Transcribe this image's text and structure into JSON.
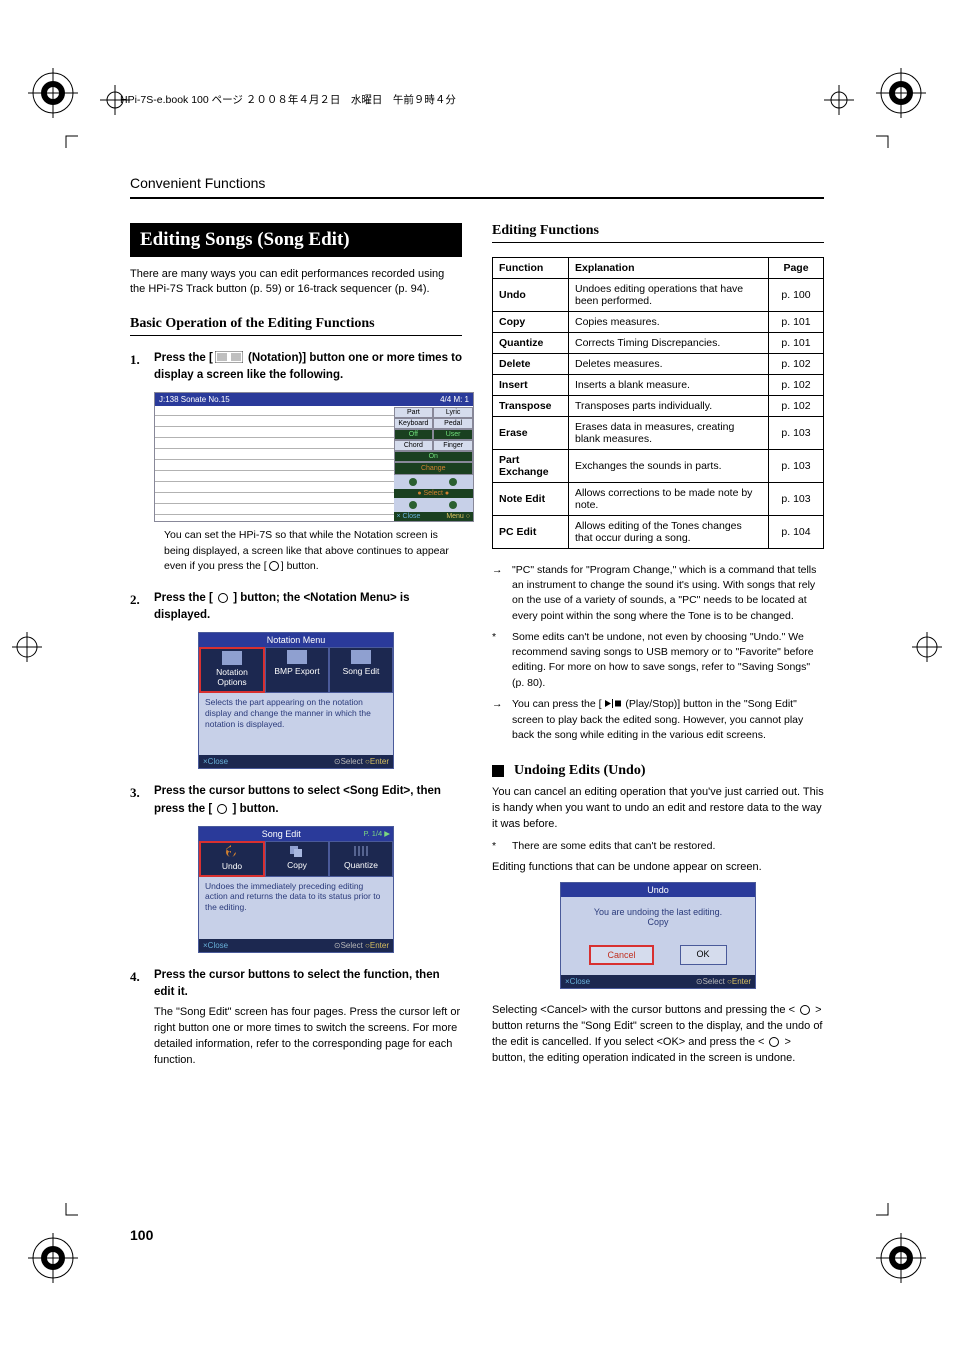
{
  "print_header": "HPi-7S-e.book  100 ページ  ２００８年４月２日　水曜日　午前９時４分",
  "running_head": "Convenient Functions",
  "title": "Editing Songs (Song Edit)",
  "intro": "There are many ways you can edit performances recorded using the HPi-7S Track button (p. 59) or 16-track sequencer (p. 94).",
  "h2_basic": "Basic Operation of the Editing Functions",
  "steps": {
    "s1": {
      "num": "1.",
      "pre": "Press the [",
      "post": " (Notation)] button one or more times to display a screen like the following."
    },
    "cap1": {
      "a": "You can set the HPi-7S so that while the Notation screen is being displayed, a screen like that above continues to appear even if you press the [",
      "b": "] button."
    },
    "s2": {
      "num": "2.",
      "pre": "Press the [ ",
      "post": " ] button; the <Notation Menu> is displayed."
    },
    "s3": {
      "num": "3.",
      "pre": "Press the cursor buttons to select <Song Edit>, then press the [ ",
      "post": " ] button."
    },
    "s4": {
      "num": "4.",
      "text": "Press the cursor buttons to select the function, then edit it."
    },
    "cap4": "The \"Song Edit\" screen has four pages. Press the cursor left or right button one or more times to switch the screens. For more detailed information, refer to the corresponding page for each function."
  },
  "shot1": {
    "title_l": "J:138 Sonate No.15",
    "title_r": "4/4  M:   1",
    "side": {
      "part": "Part",
      "lyric": "Lyric",
      "keyboard": "Keyboard",
      "pedal": "Pedal",
      "off": "Off",
      "user": "User",
      "chord": "Chord",
      "finger": "Finger",
      "on": "On",
      "change": "Change",
      "select": "● Select ●",
      "close": "× Close",
      "menu": "Menu ○"
    }
  },
  "shot2": {
    "title": "Notation Menu",
    "tabs": [
      "Notation\nOptions",
      "BMP Export",
      "Song Edit"
    ],
    "help": "Selects the part appearing on the notation display and change the manner in which the notation is displayed.",
    "close": "×Close",
    "select": "⊙Select",
    "enter": "○Enter"
  },
  "shot3": {
    "title": "Song Edit",
    "page": "P. 1/4 ▶",
    "tabs": [
      "Undo",
      "Copy",
      "Quantize"
    ],
    "help": "Undoes the immediately preceding editing action and returns the data to its status prior to the editing.",
    "close": "×Close",
    "select": "⊙Select",
    "enter": "○Enter"
  },
  "h2_editing": "Editing Functions",
  "table": {
    "head": [
      "Function",
      "Explanation",
      "Page"
    ],
    "rows": [
      [
        "Undo",
        "Undoes editing operations that have been performed.",
        "p. 100"
      ],
      [
        "Copy",
        "Copies measures.",
        "p. 101"
      ],
      [
        "Quantize",
        "Corrects Timing Discrepancies.",
        "p. 101"
      ],
      [
        "Delete",
        "Deletes measures.",
        "p. 102"
      ],
      [
        "Insert",
        "Inserts a blank measure.",
        "p. 102"
      ],
      [
        "Transpose",
        "Transposes parts individually.",
        "p. 102"
      ],
      [
        "Erase",
        "Erases data in measures, creating blank measures.",
        "p. 103"
      ],
      [
        "Part Exchange",
        "Exchanges the sounds in parts.",
        "p. 103"
      ],
      [
        "Note Edit",
        "Allows corrections to be made note by note.",
        "p. 103"
      ],
      [
        "PC Edit",
        "Allows editing of the Tones changes that occur during a song.",
        "p. 104"
      ]
    ]
  },
  "notes": {
    "n1": {
      "b": "→",
      "t": "\"PC\" stands for \"Program Change,\" which is a command that tells an instrument to change the sound it's using. With songs that rely on the use of a variety of sounds, a \"PC\" needs to be located at every point within the song where the Tone is to be changed."
    },
    "n2": {
      "b": "*",
      "t": "Some edits can't be undone, not even by choosing \"Undo.\" We recommend saving songs to USB memory or to \"Favorite\" before editing. For more on how to save songs, refer to \"Saving Songs\" (p. 80)."
    },
    "n3": {
      "b": "→",
      "pre": "You can press the [ ",
      "post": " (Play/Stop)] button in the \"Song Edit\" screen to play back the edited song. However, you cannot play back the song while editing in the various edit screens."
    }
  },
  "h3_undo": "Undoing Edits (Undo)",
  "undo_p1": "You can cancel an editing operation that you've just carried out. This is handy when you want to undo an edit and restore data to the way it was before.",
  "undo_note": {
    "b": "*",
    "t": "There are some edits that can't be restored."
  },
  "undo_p2": "Editing functions that can be undone appear on screen.",
  "shot4": {
    "title": "Undo",
    "body1": "You are undoing the last editing.",
    "body2": "Copy",
    "cancel": "Cancel",
    "ok": "OK",
    "close": "×Close",
    "select": "⊙Select",
    "enter": "○Enter"
  },
  "undo_p3": {
    "a": "Selecting <Cancel> with the cursor buttons and pressing the < ",
    "b": " > button returns the \"Song Edit\" screen to the display, and the undo of the edit is cancelled. If you select <OK> and press the < ",
    "c": " > button, the editing operation indicated in the screen is undone."
  },
  "page_number": "100"
}
